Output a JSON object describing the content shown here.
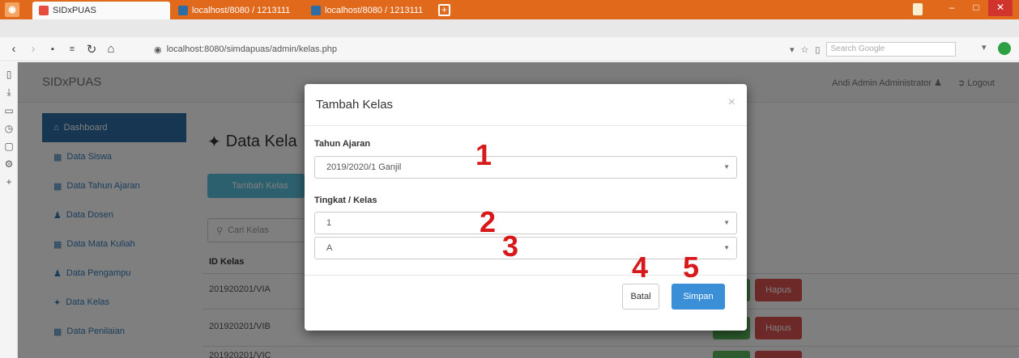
{
  "browser": {
    "tabs": [
      {
        "label": "SIDxPUAS",
        "active": true
      },
      {
        "label": "localhost/8080 / 1213111",
        "active": false
      },
      {
        "label": "localhost/8080 / 1213111",
        "active": false
      }
    ],
    "address": "localhost:8080/simdapuas/admin/kelas.php",
    "search_placeholder": "Search Google",
    "accent_color": "#e0691c"
  },
  "page": {
    "brand": "SIDxPUAS",
    "user_label": "Andi Admin Administrator",
    "logout_label": "Logout",
    "title": "Data Kela",
    "add_button_label": "Tambah Kelas",
    "search_placeholder": "Cari Kelas",
    "sidebar": [
      {
        "label": "Dashboard",
        "active": true
      },
      {
        "label": "Data Siswa",
        "active": false
      },
      {
        "label": "Data Tahun Ajaran",
        "active": false
      },
      {
        "label": "Data Dosen",
        "active": false
      },
      {
        "label": "Data Mata Kuliah",
        "active": false
      },
      {
        "label": "Data Pengampu",
        "active": false
      },
      {
        "label": "Data Kelas",
        "active": false
      },
      {
        "label": "Data Penilaian",
        "active": false
      }
    ],
    "table": {
      "header": "ID Kelas",
      "rows": [
        "201920201/VIA",
        "201920201/VIB",
        "201920201/VIC"
      ],
      "delete_label": "Hapus"
    }
  },
  "modal": {
    "title": "Tambah Kelas",
    "fields": {
      "tahun_label": "Tahun Ajaran",
      "tahun_value": "2019/2020/1 Ganjil",
      "tingkat_label": "Tingkat / Kelas",
      "tingkat_value": "1",
      "kelas_value": "A"
    },
    "cancel_label": "Batal",
    "save_label": "Simpan"
  },
  "annotations": [
    "1",
    "2",
    "3",
    "4",
    "5"
  ]
}
